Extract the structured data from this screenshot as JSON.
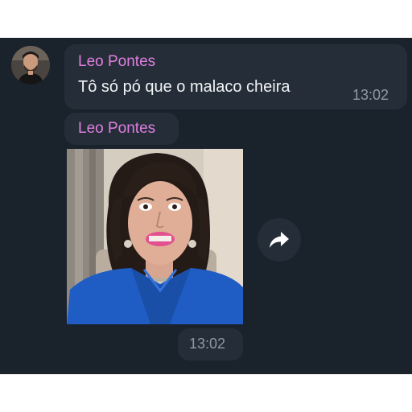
{
  "messages": [
    {
      "sender": "Leo Pontes",
      "text": "Tô só pó que o malaco cheira",
      "time": "13:02"
    },
    {
      "sender": "Leo Pontes",
      "type": "gif",
      "time": "13:02"
    }
  ],
  "icons": {
    "avatar": "avatar",
    "forward": "forward-arrow-icon"
  },
  "colors": {
    "background": "#1a222c",
    "bubble": "#252e38",
    "sender_name": "#e07ee0",
    "message_text": "#f2f4f6",
    "timestamp": "#8d99a6"
  }
}
